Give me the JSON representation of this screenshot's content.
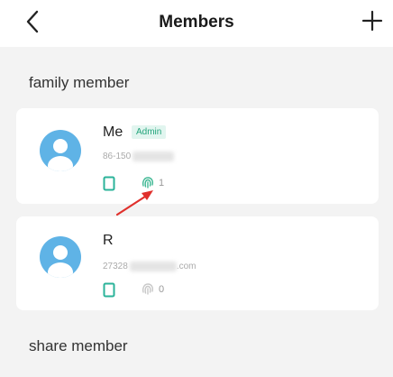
{
  "header": {
    "title": "Members"
  },
  "sections": {
    "family": "family member",
    "share": "share member"
  },
  "members": [
    {
      "name": "Me",
      "badge": "Admin",
      "contact_prefix": "86-150",
      "contact_suffix": "",
      "fingerprint_count": "1"
    },
    {
      "name": "R",
      "badge": "",
      "contact_prefix": "27328",
      "contact_suffix": ".com",
      "fingerprint_count": "0"
    }
  ],
  "colors": {
    "accent": "#24a57c",
    "avatar": "#5fb3e6",
    "phone_icon": "#2bb39a",
    "arrow": "#e0302c"
  },
  "icons": {
    "back": "chevron-left-icon",
    "add": "plus-icon",
    "device": "phone-icon",
    "credential": "fingerprint-icon"
  }
}
